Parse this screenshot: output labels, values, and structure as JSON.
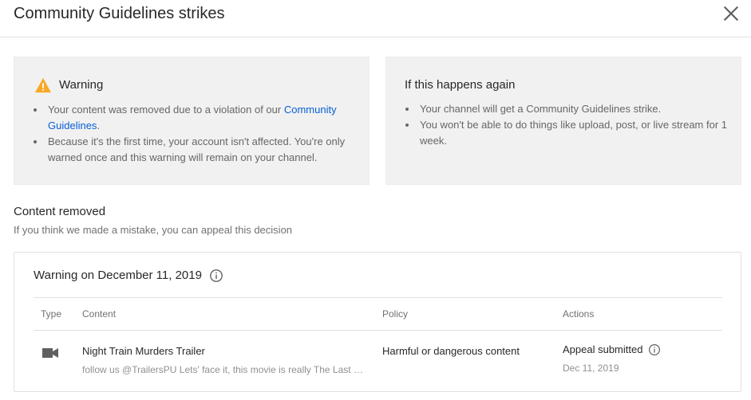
{
  "dialog": {
    "title": "Community Guidelines strikes",
    "close_icon": "close-icon"
  },
  "warning_card": {
    "icon": "warning-triangle-icon",
    "icon_color": "#f9a825",
    "title": "Warning",
    "bullets": [
      {
        "text": "Your content was removed due to a violation of our ",
        "link": "Community Guidelines",
        "suffix": "."
      },
      {
        "text": "Because it's the first time, your account isn't affected. You're only warned once and this warning will remain on your channel."
      }
    ]
  },
  "repeat_card": {
    "title": "If this happens again",
    "bullets": [
      "Your channel will get a Community Guidelines strike.",
      "You won't be able to do things like upload, post, or live stream for 1 week."
    ]
  },
  "content_removed": {
    "title": "Content removed",
    "subtitle": "If you think we made a mistake, you can appeal this decision"
  },
  "strike_panel": {
    "title": "Warning on December 11, 2019",
    "info_icon": "info-icon",
    "columns": [
      "Type",
      "Content",
      "Policy",
      "Actions"
    ],
    "row": {
      "type_icon": "video-camera-icon",
      "content_title": "Night Train Murders Trailer",
      "content_desc": "follow us @TrailersPU Lets' face it, this movie is really The Last House on the Left on a train",
      "policy": "Harmful or dangerous content",
      "action_status": "Appeal submitted",
      "action_date": "Dec 11, 2019"
    }
  },
  "colors": {
    "link": "#065fd4",
    "card_bg": "#f1f1f1",
    "text_primary": "#282828",
    "text_secondary": "#717171"
  }
}
